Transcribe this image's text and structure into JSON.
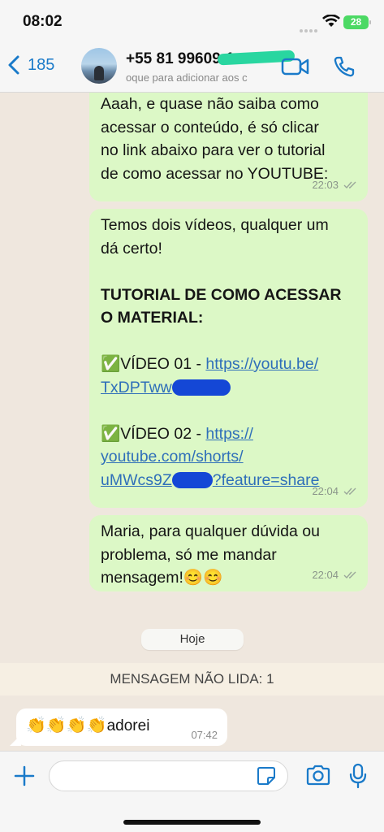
{
  "status": {
    "time": "08:02",
    "battery": "28"
  },
  "header": {
    "back_count": "185",
    "contact_name": "+55 81 99609-1",
    "subtitle": "oque para adicionar aos c"
  },
  "messages": {
    "m1": {
      "lines": [
        "Aaah, e quase não saiba como",
        "acessar o conteúdo, é só clicar",
        "no link abaixo para ver o tutorial",
        "de como acessar no YOUTUBE:"
      ],
      "time": "22:03"
    },
    "m2": {
      "line1": "Temos dois vídeos, qualquer um",
      "line2": "dá certo!",
      "heading1": "TUTORIAL DE COMO ACESSAR",
      "heading2": "O MATERIAL:",
      "video1_check": "✅",
      "video1_label": "VÍDEO 01 - ",
      "video1_link_a": "https://youtu.be/",
      "video1_link_b": "TxDPTww",
      "video2_check": "✅",
      "video2_label": "VÍDEO 02 - ",
      "video2_link_a": "https://",
      "video2_link_b": "youtube.com/shorts/",
      "video2_link_c": "uMWcs9Z",
      "video2_link_d": "?feature=share",
      "time": "22:04"
    },
    "m3": {
      "lines": [
        "Maria, para qualquer dúvida ou",
        "problema, só me mandar",
        "mensagem!😊😊"
      ],
      "time": "22:04"
    },
    "date_separator": "Hoje",
    "unread_label": "MENSAGEM NÃO LIDA: 1",
    "incoming": {
      "emojis": "👏👏👏👏",
      "text": "adorei",
      "time": "07:42"
    }
  },
  "colors": {
    "outgoing_bubble": "#dcf8c6",
    "chat_background": "#efe7de",
    "accent_blue": "#1a7ac9",
    "link": "#2f6fb9"
  },
  "icons": [
    "back-chevron-icon",
    "video-call-icon",
    "phone-icon",
    "plus-icon",
    "sticker-icon",
    "camera-icon",
    "microphone-icon",
    "double-check-icon",
    "wifi-icon"
  ]
}
